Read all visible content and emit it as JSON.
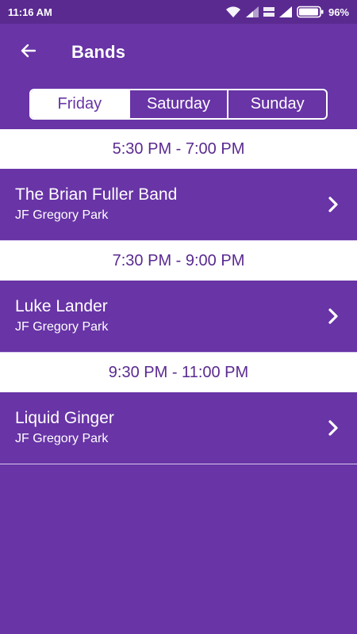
{
  "status_bar": {
    "time": "11:16 AM",
    "battery_percent": "96%",
    "battery_level": 0.96
  },
  "header": {
    "title": "Bands"
  },
  "tabs": [
    {
      "label": "Friday",
      "active": true
    },
    {
      "label": "Saturday",
      "active": false
    },
    {
      "label": "Sunday",
      "active": false
    }
  ],
  "schedule": [
    {
      "time": "5:30 PM - 7:00 PM",
      "band": "The Brian Fuller Band",
      "venue": "JF Gregory Park"
    },
    {
      "time": "7:30 PM - 9:00 PM",
      "band": "Luke Lander",
      "venue": "JF Gregory Park"
    },
    {
      "time": "9:30 PM - 11:00 PM",
      "band": "Liquid Ginger",
      "venue": "JF Gregory Park"
    }
  ],
  "colors": {
    "primary": "#6834a6",
    "status_bar": "#5a2a91",
    "time_text": "#5a2a91",
    "header_bg": "#ffffff"
  },
  "icons": {
    "back": "arrow-left-icon",
    "row": "chevron-right-icon",
    "wifi": "wifi-icon",
    "signal": "signal-icon",
    "volte": "volte-icon",
    "battery": "battery-icon"
  }
}
